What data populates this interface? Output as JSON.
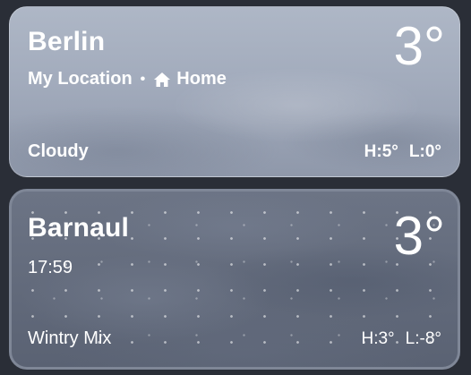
{
  "locations": [
    {
      "city": "Berlin",
      "subtitle_primary": "My Location",
      "separator": "•",
      "subtitle_secondary": "Home",
      "temperature": "3°",
      "condition": "Cloudy",
      "high": "H:5°",
      "low": "L:0°"
    },
    {
      "city": "Barnaul",
      "time": "17:59",
      "temperature": "3°",
      "condition": "Wintry Mix",
      "high": "H:3°",
      "low": "L:-8°"
    }
  ],
  "icons": {
    "home": "house-icon"
  },
  "colors": {
    "background": "#2a2e37",
    "card_1": "#a2abbc",
    "card_2": "#636b7c",
    "selected_border": "#7f8797",
    "text": "#ffffff"
  }
}
